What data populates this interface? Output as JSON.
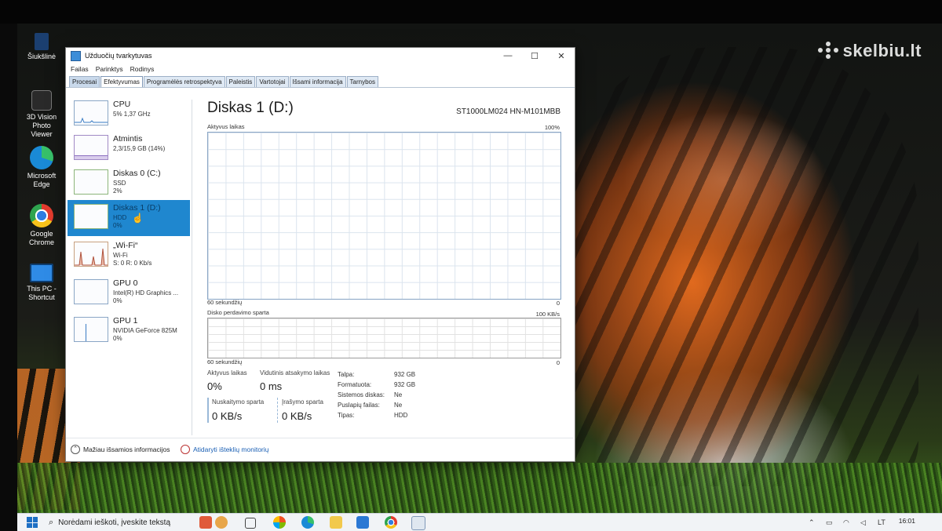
{
  "watermark": {
    "text": "skelbiu.lt"
  },
  "desktop_icons": [
    {
      "label": "Šiukšlinė",
      "icon": "recycle-bin-icon"
    },
    {
      "label": "3D Vision Photo Viewer",
      "icon": "3d-vision-icon"
    },
    {
      "label": "Microsoft Edge",
      "icon": "edge-icon"
    },
    {
      "label": "Google Chrome",
      "icon": "chrome-icon"
    },
    {
      "label": "This PC - Shortcut",
      "icon": "this-pc-icon"
    }
  ],
  "window": {
    "title": "Užduočių tvarkytuvas",
    "controls": {
      "minimize": "—",
      "maximize": "☐",
      "close": "✕"
    },
    "menu": [
      "Failas",
      "Parinktys",
      "Rodinys"
    ],
    "tabs": [
      "Procesai",
      "Efektyvumas",
      "Programėlės retrospektyva",
      "Paleistis",
      "Vartotojai",
      "Išsami informacija",
      "Tarnybos"
    ],
    "active_tab": "Efektyvumas"
  },
  "sidebar": [
    {
      "name": "CPU",
      "sub1": "5% 1,37 GHz",
      "sub2": ""
    },
    {
      "name": "Atmintis",
      "sub1": "2,3/15,9 GB (14%)",
      "sub2": ""
    },
    {
      "name": "Diskas 0 (C:)",
      "sub1": "SSD",
      "sub2": "2%"
    },
    {
      "name": "Diskas 1 (D:)",
      "sub1": "HDD",
      "sub2": "0%",
      "selected": true
    },
    {
      "name": "„Wi-Fi“",
      "sub1": "Wi-Fi",
      "sub2": "S: 0 R: 0 Kb/s"
    },
    {
      "name": "GPU 0",
      "sub1": "Intel(R) HD Graphics ...",
      "sub2": "0%"
    },
    {
      "name": "GPU 1",
      "sub1": "NVIDIA GeForce 825M",
      "sub2": "0%"
    }
  ],
  "main": {
    "title": "Diskas 1 (D:)",
    "model": "ST1000LM024 HN-M101MBB",
    "graph1": {
      "label": "Aktyvus laikas",
      "max": "100%",
      "time": "60 sekundžių",
      "min": "0"
    },
    "graph2": {
      "label": "Disko perdavimo sparta",
      "max": "100 KB/s",
      "time": "60 sekundžių",
      "min": "0"
    },
    "stats": {
      "active_label": "Aktyvus laikas",
      "active_value": "0%",
      "response_label": "Vidutinis atsakymo laikas",
      "response_value": "0 ms",
      "read_label": "Nuskaitymo sparta",
      "read_value": "0 KB/s",
      "write_label": "Įrašymo sparta",
      "write_value": "0 KB/s"
    },
    "properties": [
      {
        "key": "Talpa:",
        "value": "932 GB"
      },
      {
        "key": "Formatuota:",
        "value": "932 GB"
      },
      {
        "key": "Sistemos diskas:",
        "value": "Ne"
      },
      {
        "key": "Puslapių failas:",
        "value": "Ne"
      },
      {
        "key": "Tipas:",
        "value": "HDD"
      }
    ]
  },
  "footer": {
    "fewer_details": "Mažiau išsamios informacijos",
    "resource_monitor": "Atidaryti išteklių monitorių"
  },
  "taskbar": {
    "search_placeholder": "Norėdami ieškoti, įveskite tekstą",
    "time": "16:01",
    "lang": "LT"
  },
  "colors": {
    "selection": "#1f87cf",
    "graph_border": "#8aa6c5",
    "link": "#1a5fb4"
  }
}
